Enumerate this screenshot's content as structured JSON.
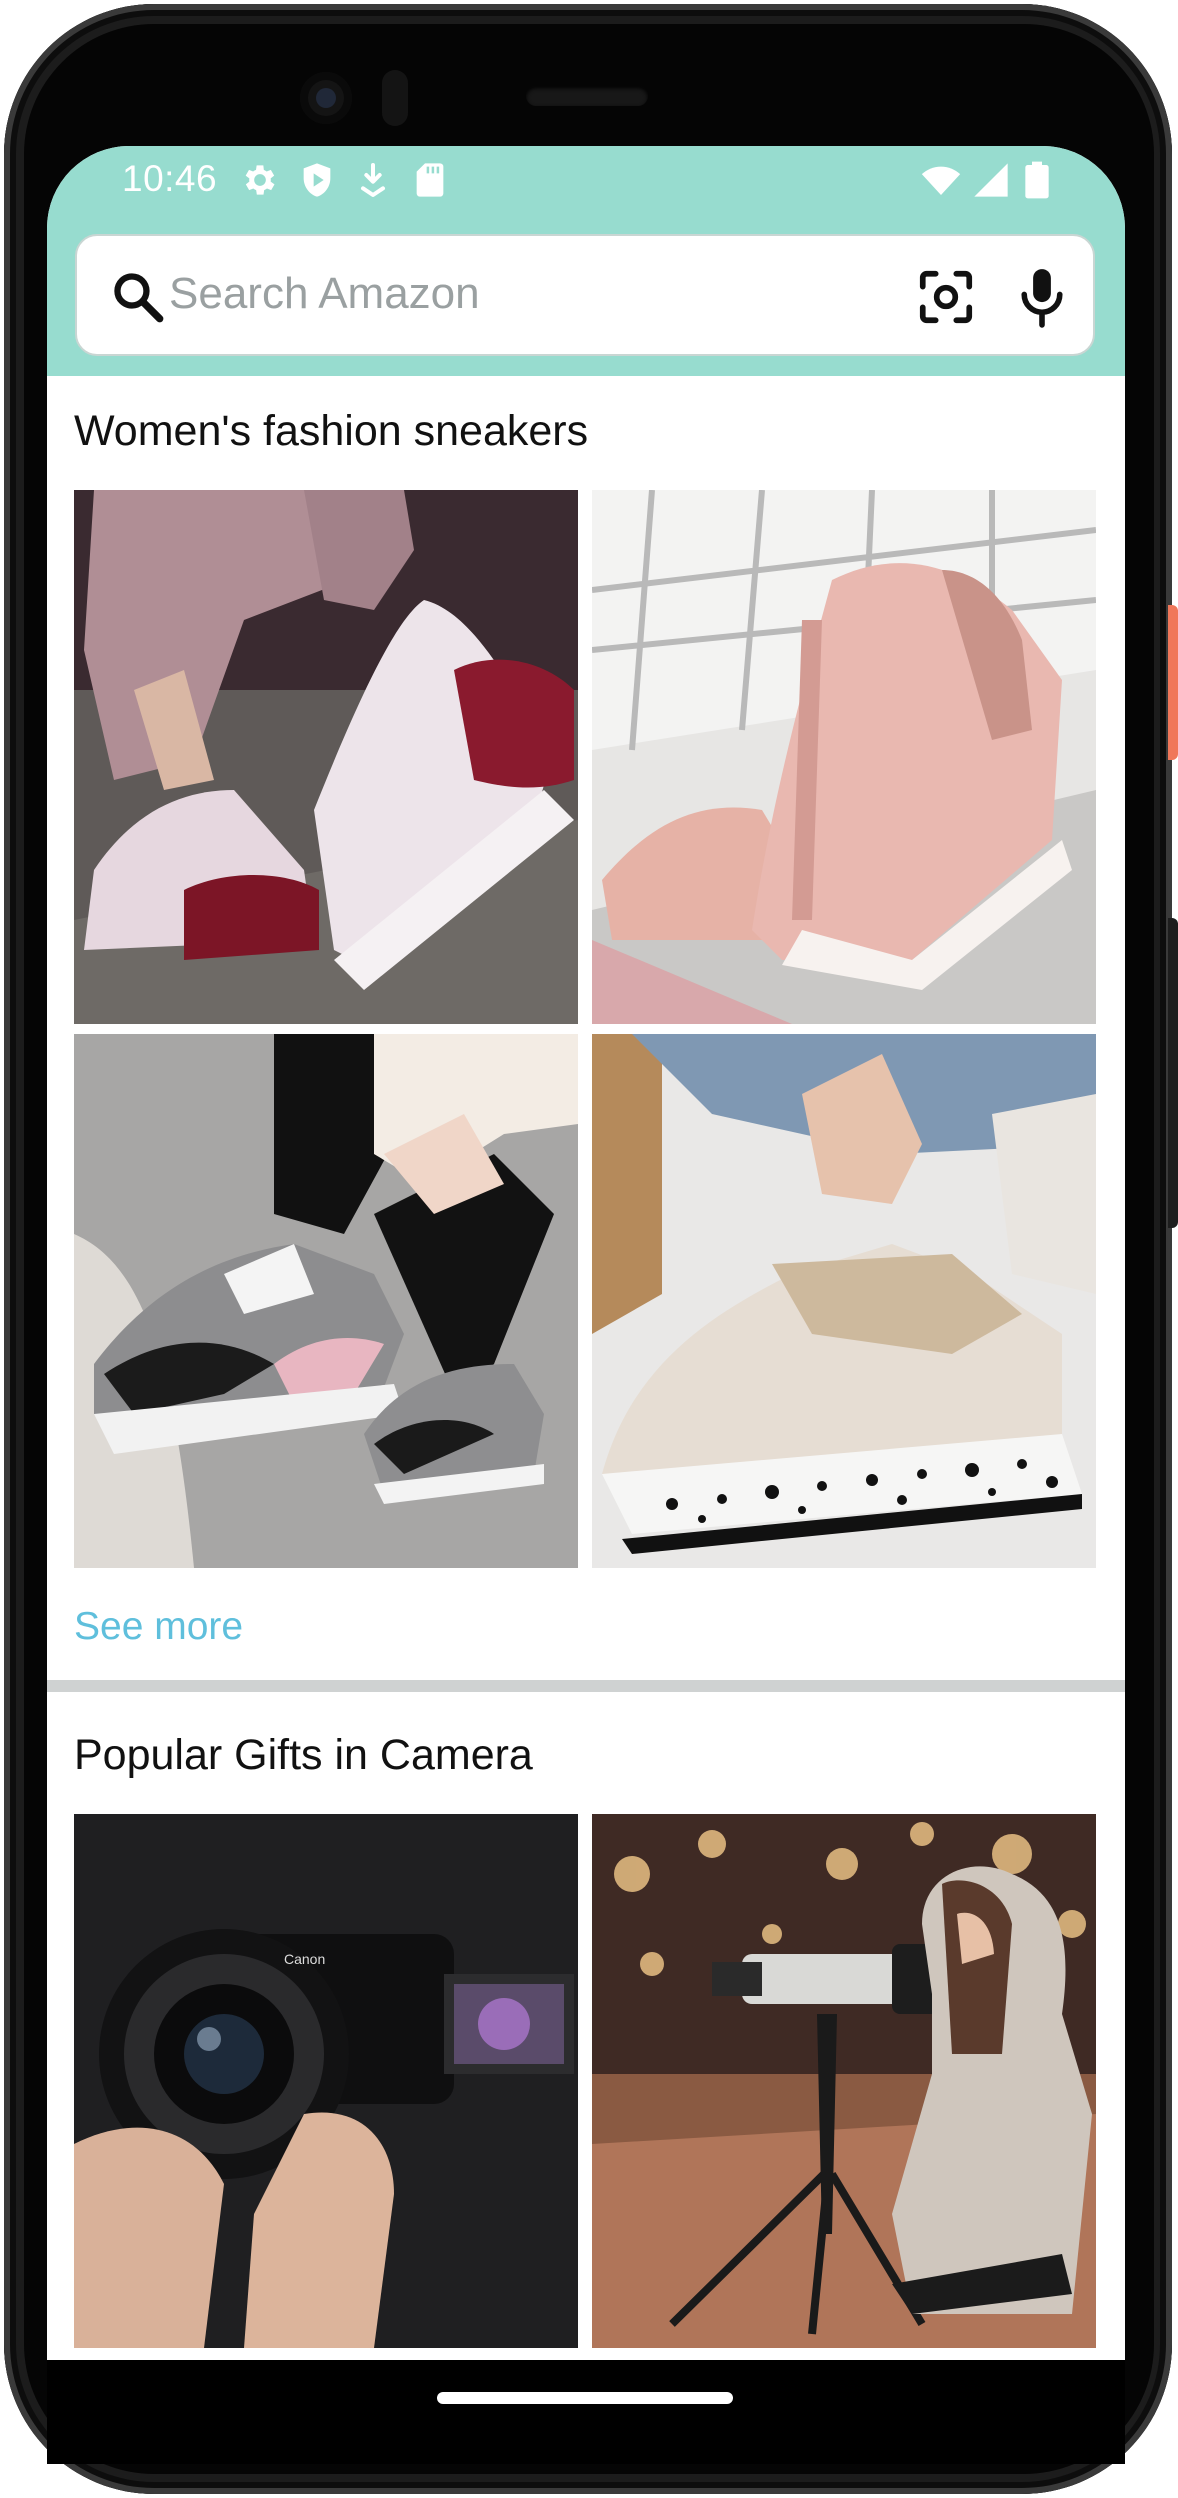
{
  "status_bar": {
    "time": "10:46",
    "left_icons": [
      "gear-icon",
      "shield-play-icon",
      "download-icon",
      "sd-card-icon"
    ],
    "right_icons": [
      "wifi-icon",
      "cell-signal-icon",
      "battery-icon"
    ]
  },
  "search": {
    "placeholder": "Search Amazon",
    "icons": [
      "search-icon",
      "camera-lens-icon",
      "mic-icon"
    ]
  },
  "header_color": "#97dccf",
  "sections": [
    {
      "title": "Women's fashion sneakers",
      "link_label": "See more",
      "tiles": [
        "pink-red-sneakers-tile",
        "blush-wedge-sneakers-tile",
        "grey-pink-sneakers-tile",
        "leopard-platform-sneakers-tile"
      ]
    },
    {
      "title": "Popular Gifts in Camera",
      "tiles": [
        "canon-camera-tile",
        "tripod-camera-tile"
      ]
    }
  ],
  "link_color": "#5fbfdc"
}
